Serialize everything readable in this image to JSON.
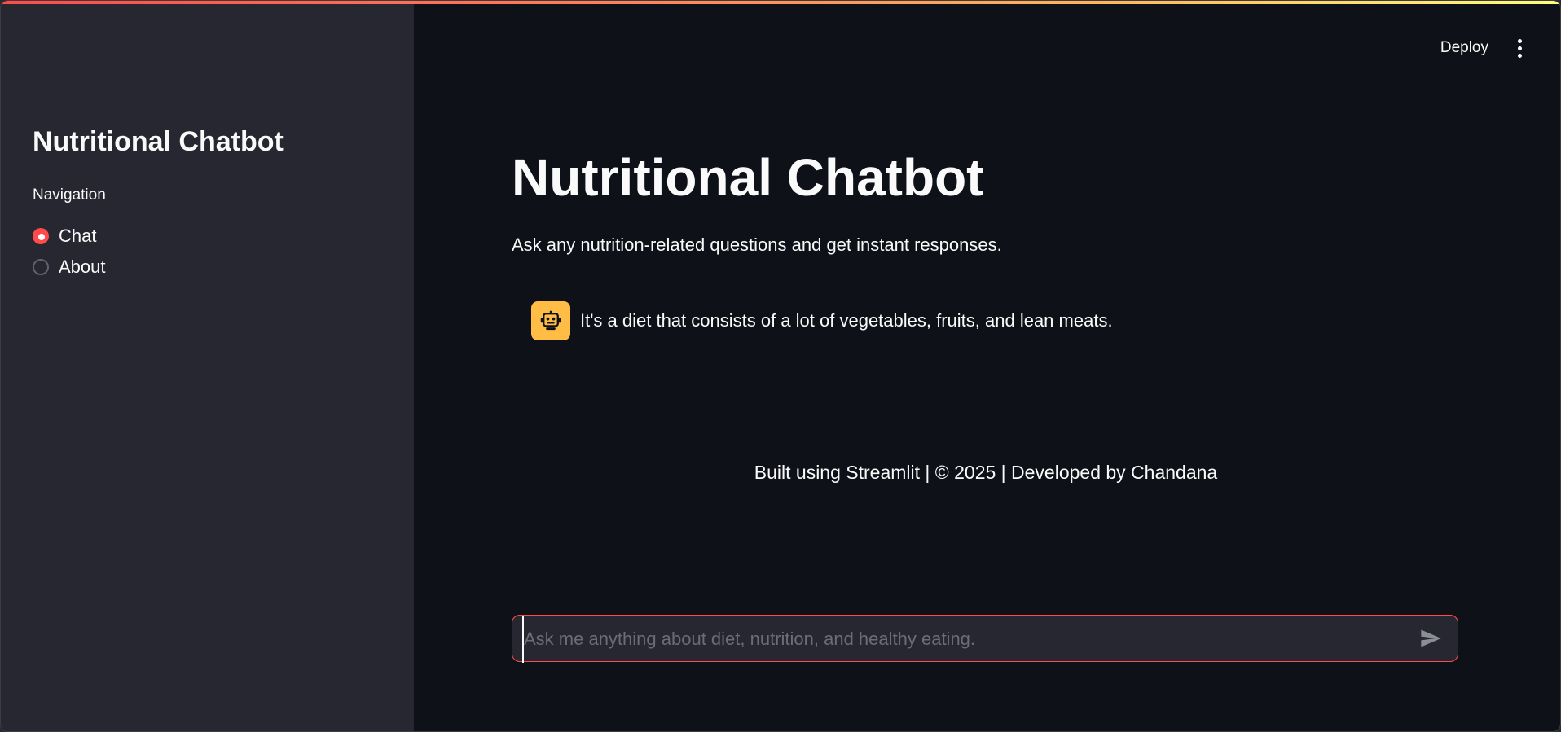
{
  "sidebar": {
    "title": "Nutritional Chatbot",
    "nav_label": "Navigation",
    "options": [
      {
        "label": "Chat",
        "selected": true
      },
      {
        "label": "About",
        "selected": false
      }
    ]
  },
  "header": {
    "deploy_label": "Deploy",
    "menu_icon": "kebab-menu-icon"
  },
  "main": {
    "title": "Nutritional Chatbot",
    "subtitle": "Ask any nutrition-related questions and get instant responses.",
    "messages": [
      {
        "role": "assistant",
        "avatar_icon": "robot-icon",
        "text": "It's a diet that consists of a lot of vegetables, fruits, and lean meats."
      }
    ],
    "footer": "Built using Streamlit | © 2025 | Developed by Chandana"
  },
  "chat_input": {
    "placeholder": "Ask me anything about diet, nutrition, and healthy eating.",
    "value": "",
    "send_icon": "send-icon"
  },
  "colors": {
    "accent": "#ff4b4b",
    "avatar_bg": "#ffbd45",
    "background": "#0e1117",
    "sidebar_bg": "#262730"
  }
}
